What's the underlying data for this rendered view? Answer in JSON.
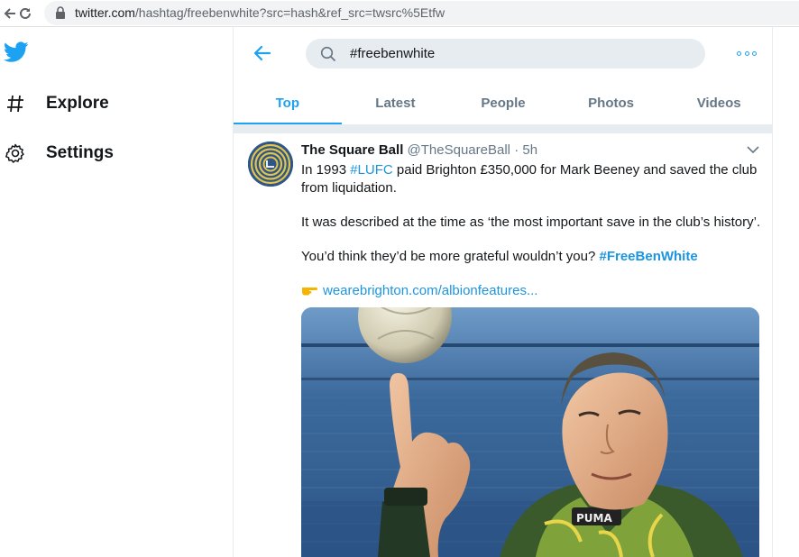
{
  "browser": {
    "url_host": "twitter.com",
    "url_path": "/hashtag/freebenwhite?src=hash&ref_src=twsrc%5Etfw"
  },
  "sidebar": {
    "items": [
      {
        "label": "Explore",
        "icon": "hashtag-icon"
      },
      {
        "label": "Settings",
        "icon": "gear-icon"
      }
    ]
  },
  "header": {
    "search_value": "#freebenwhite",
    "tabs": [
      "Top",
      "Latest",
      "People",
      "Photos",
      "Videos"
    ],
    "active_tab": "Top"
  },
  "tweet": {
    "name": "The Square Ball",
    "handle": "@TheSquareBall",
    "separator": "·",
    "time": "5h",
    "p1_pre": "In 1993 ",
    "p1_tag": "#LUFC",
    "p1_post": " paid Brighton £350,000 for Mark Beeney and saved the club from liquidation.",
    "p2": "It was described at the time as ‘the most important save in the club’s history’.",
    "p3_pre": "You’d think they’d be more grateful wouldn’t you? ",
    "p3_tag": "#FreeBenWhite",
    "link": "wearebrighton.com/albionfeatures..."
  },
  "colors": {
    "accent": "#1da1f2",
    "link": "#1b95e0",
    "muted": "#657786",
    "divider": "#e6ecf0"
  }
}
